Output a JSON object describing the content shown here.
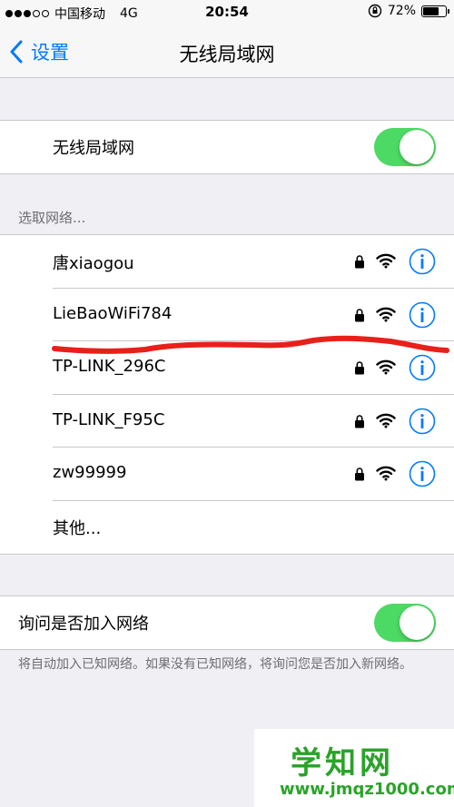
{
  "status_bar": {
    "carrier": "中国移动",
    "network": "4G",
    "time": "20:54",
    "battery": "72%",
    "battery_level": 0.72,
    "signal_bars_filled": 3,
    "signal_bars_total": 5
  },
  "nav": {
    "back_label": "设置",
    "title": "无线局域网"
  },
  "wifi_toggle": {
    "label": "无线局域网",
    "on": true
  },
  "networks_section": {
    "header": "选取网络...",
    "networks": [
      {
        "name": "唐xiaogou",
        "locked": true
      },
      {
        "name": "LieBaoWiFi784",
        "locked": true
      },
      {
        "name": "TP-LINK_296C",
        "locked": true
      },
      {
        "name": "TP-LINK_F95C",
        "locked": true
      },
      {
        "name": "zw99999",
        "locked": true
      }
    ],
    "other_label": "其他..."
  },
  "ask_join": {
    "label": "询问是否加入网络",
    "on": true,
    "footer": "将自动加入已知网络。如果没有已知网络，将询问您是否加入新网络。"
  },
  "watermark": {
    "brand": "学知网",
    "url": "www.jmqz1000.com"
  },
  "colors": {
    "accent": "#007aff",
    "toggle_on": "#4cd964",
    "annotation": "#e8201a",
    "watermark": "#2aa329"
  }
}
